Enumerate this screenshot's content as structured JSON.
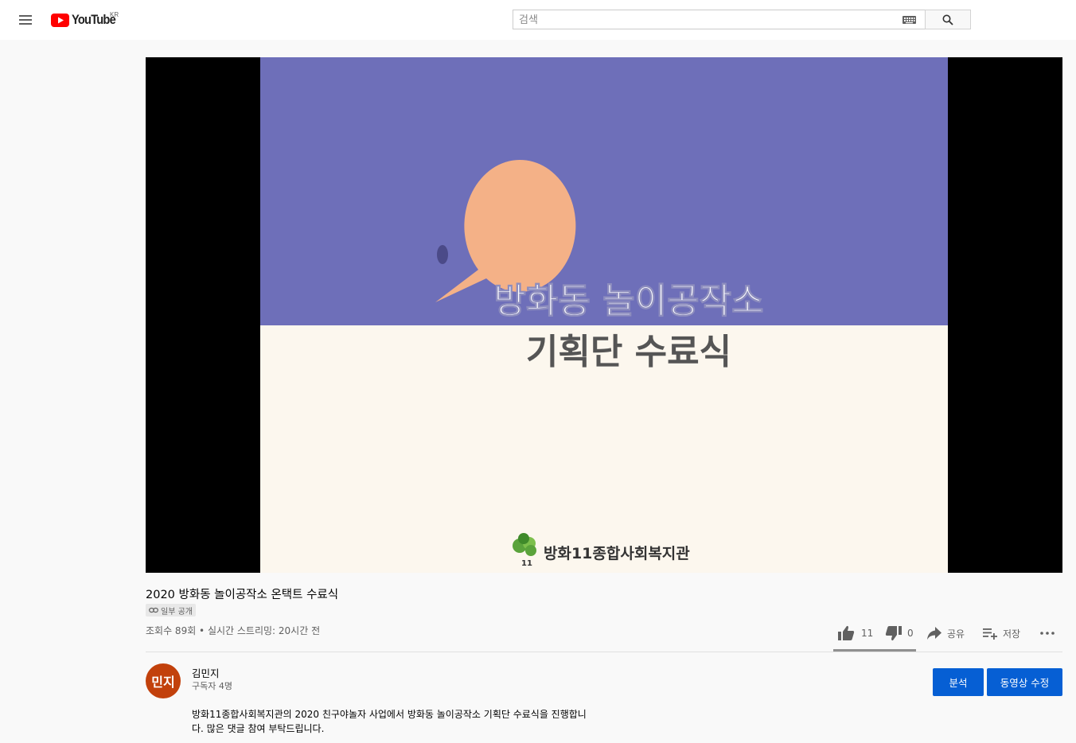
{
  "header": {
    "logo_text": "YouTube",
    "region": "KR",
    "search_placeholder": "검색"
  },
  "video": {
    "frame_title_line1": "방화동 놀이공작소",
    "frame_title_line2": "기획단 수료식",
    "frame_org": "방화11종합사회복지관",
    "frame_logo_number": "11",
    "title": "2020 방화동 놀이공작소 온택트 수료식",
    "visibility": "일부 공개",
    "stats": "조회수 89회 • 실시간 스트리밍: 20시간 전"
  },
  "actions": {
    "like_count": "11",
    "dislike_count": "0",
    "share_label": "공유",
    "save_label": "저장"
  },
  "channel": {
    "avatar_text": "민지",
    "name": "김민지",
    "subscribers": "구독자 4명"
  },
  "buttons": {
    "analytics": "분석",
    "edit_video": "동영상 수정"
  },
  "description": {
    "line1": "방화11종합사회복지관의 2020 친구야놀자 사업에서 방화동 놀이공작소 기획단 수료식을 진행합니",
    "line2": "다. 많은 댓글 참여 부탁드립니다."
  },
  "colors": {
    "brand_red": "#ff0000",
    "accent_blue": "#065fd4",
    "frame_purple": "#6e6fb9",
    "frame_cream": "#fcf7ee",
    "pacman": "#f4b187",
    "avatar": "#c2410c"
  }
}
